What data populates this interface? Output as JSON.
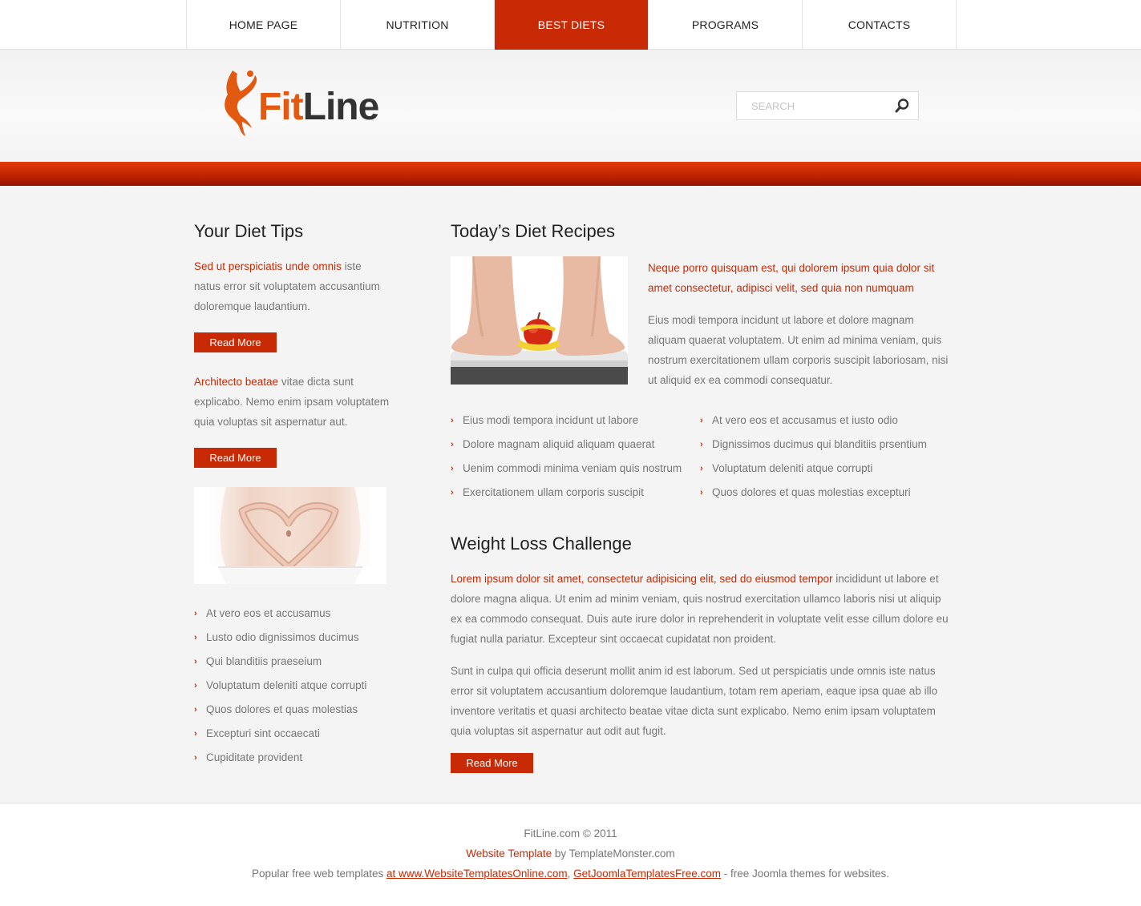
{
  "nav": {
    "items": [
      {
        "label": "HOME PAGE"
      },
      {
        "label": "NUTRITION"
      },
      {
        "label": "BEST DIETS"
      },
      {
        "label": "PROGRAMS"
      },
      {
        "label": "CONTACTS"
      }
    ],
    "active_index": 2
  },
  "header": {
    "logo_fit": "Fit",
    "logo_line": "Line",
    "search_placeholder": "SEARCH"
  },
  "colors": {
    "accent": "#c72a05",
    "logo_orange": "#e5580f"
  },
  "left": {
    "title": "Your Diet Tips",
    "tips": [
      {
        "highlight": "Sed ut perspiciatis unde omnis",
        "text": " iste natus error sit voluptatem accusantium doloremque laudantium.",
        "button": "Read More"
      },
      {
        "highlight": "Architecto beatae",
        "text": " vitae dicta sunt explicabo. Nemo enim ipsam voluptatem quia voluptas sit aspernatur aut.",
        "button": "Read More"
      }
    ],
    "list": [
      "At vero eos et accusamus",
      "Lusto odio dignissimos ducimus",
      "Qui blanditiis praeseium",
      "Voluptatum deleniti atque corrupti",
      "Quos dolores et quas molestias",
      "Excepturi sint occaecati",
      "Cupiditate provident"
    ]
  },
  "recipes": {
    "title": "Today’s Diet Recipes",
    "highlight": "Neque porro quisquam est, qui dolorem ipsum quia dolor sit amet consectetur, adipisci velit, sed quia non numquam",
    "body": "Eius modi tempora incidunt ut labore et dolore magnam aliquam quaerat voluptatem. Ut enim ad minima veniam, quis nostrum exercitationem ullam corporis suscipit laboriosam, nisi ut aliquid ex ea commodi consequatur.",
    "col1": [
      "Eius modi tempora incidunt ut labore",
      "Dolore magnam aliquid aliquam quaerat",
      "Uenim commodi minima veniam quis nostrum",
      "Exercitationem ullam corporis suscipit"
    ],
    "col2": [
      "At vero eos et accusamus et iusto odio",
      "Dignissimos ducimus qui blanditiis prsentium",
      "Voluptatum deleniti atque corrupti",
      "Quos dolores et quas molestias excepturi"
    ]
  },
  "weight_loss": {
    "title": "Weight Loss Challenge",
    "p1_highlight": "Lorem ipsum dolor sit amet, consectetur adipisicing elit, sed do eiusmod tempor",
    "p1_text": " incididunt ut labore et dolore magna aliqua. Ut enim ad minim veniam, quis nostrud exercitation ullamco laboris nisi ut aliquip ex ea commodo consequat. Duis aute irure dolor in reprehenderit in voluptate velit esse cillum dolore eu fugiat nulla pariatur. Excepteur sint occaecat cupidatat non proident.",
    "p2": "Sunt in culpa qui officia deserunt mollit anim id est laborum. Sed ut perspiciatis unde omnis iste natus error sit voluptatem accusantium doloremque laudantium, totam rem aperiam, eaque ipsa quae ab illo inventore veritatis et quasi architecto beatae vitae dicta sunt explicabo. Nemo enim ipsam voluptatem quia voluptas sit aspernatur aut odit aut fugit.",
    "button": "Read More"
  },
  "footer": {
    "copyright": "FitLine.com © 2011",
    "template_link": "Website Template",
    "template_by": " by TemplateMonster.com",
    "popular_prefix": "Popular free web templates ",
    "link1": "at www.WebsiteTemplatesOnline.com",
    "sep": ", ",
    "link2": "GetJoomlaTemplatesFree.com",
    "suffix": " - free Joomla themes for websites."
  }
}
